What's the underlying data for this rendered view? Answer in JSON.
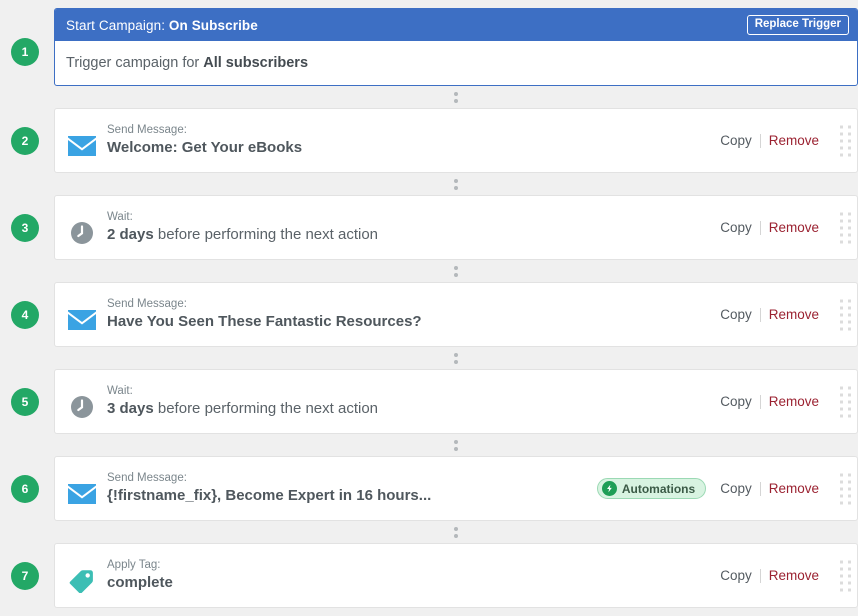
{
  "colors": {
    "page_bg": "#f0f0f0",
    "trigger_blue": "#3d6fc4",
    "step_badge_green": "#23a866",
    "badge_green": "#1e9e56",
    "remove_red": "#9b2231",
    "email_blue": "#3aa3e3",
    "wait_gray": "#8b959b",
    "tag_teal": "#3cbeb4"
  },
  "trigger": {
    "step_number": "1",
    "title_prefix": "Start Campaign:",
    "title_value": "On Subscribe",
    "replace_button": "Replace Trigger",
    "body_prefix": "Trigger campaign for",
    "body_value": "All subscribers"
  },
  "connector": {
    "icon": "vertical-ellipsis-add-step-icon"
  },
  "row_actions": {
    "copy": "Copy",
    "remove": "Remove"
  },
  "steps": [
    {
      "step_number": "2",
      "icon": "email-icon",
      "kicker": "Send Message:",
      "title_bold": "Welcome: Get Your eBooks",
      "title_rest": "",
      "badge": null
    },
    {
      "step_number": "3",
      "icon": "clock-icon",
      "kicker": "Wait:",
      "title_bold": "2 days",
      "title_rest": " before performing the next action",
      "badge": null
    },
    {
      "step_number": "4",
      "icon": "email-icon",
      "kicker": "Send Message:",
      "title_bold": "Have You Seen These Fantastic Resources?",
      "title_rest": "",
      "badge": null
    },
    {
      "step_number": "5",
      "icon": "clock-icon",
      "kicker": "Wait:",
      "title_bold": "3 days",
      "title_rest": " before performing the next action",
      "badge": null
    },
    {
      "step_number": "6",
      "icon": "email-icon",
      "kicker": "Send Message:",
      "title_bold": "{!firstname_fix}, Become Expert in 16 hours...",
      "title_rest": "",
      "badge": {
        "label": "Automations",
        "icon": "lightning-bolt-icon"
      }
    },
    {
      "step_number": "7",
      "icon": "tag-icon",
      "kicker": "Apply Tag:",
      "title_bold": "complete",
      "title_rest": "",
      "badge": null
    }
  ]
}
